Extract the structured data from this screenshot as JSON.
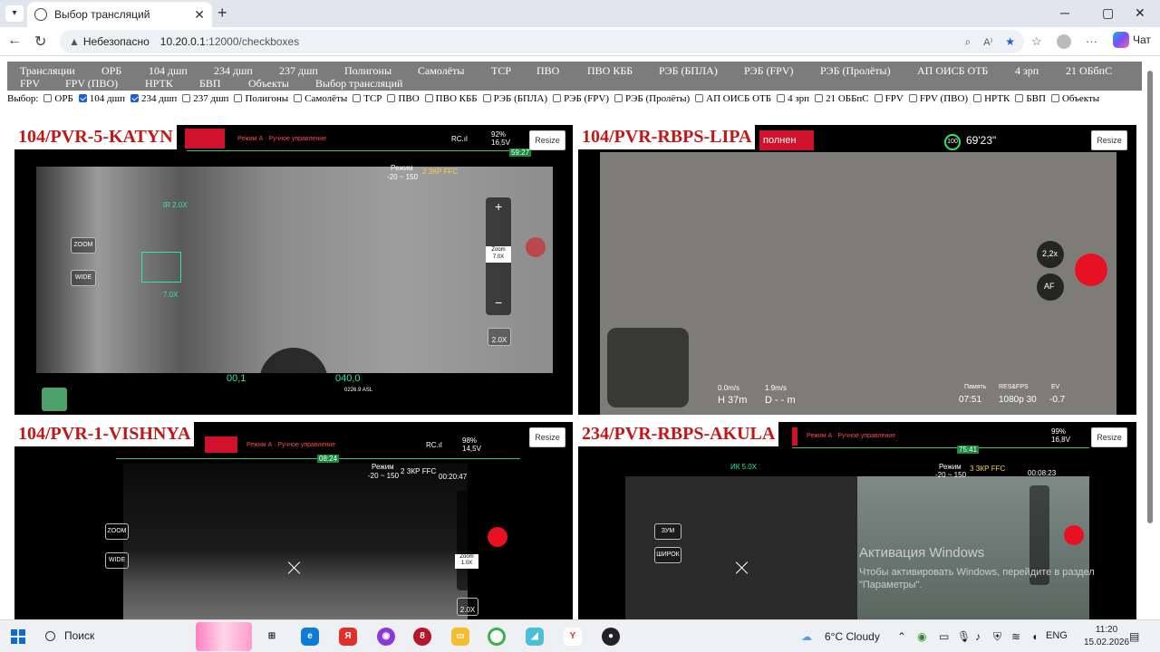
{
  "browser": {
    "tab_title": "Выбор трансляций",
    "tab_close": "✕",
    "new_tab": "+",
    "security_label": "Небезопасно",
    "url_host": "10.20.0.1",
    "url_rest": ":12000/checkboxes",
    "chat_label": "Чат"
  },
  "menu": {
    "items": [
      "Трансляции",
      "ОРБ",
      "104 дшп",
      "234 дшп",
      "237 дшп",
      "Полигоны",
      "Самолёты",
      "ТСР",
      "ПВО",
      "ПВО КББ",
      "РЭБ (БПЛА)",
      "РЭБ (FPV)",
      "РЭБ (Пролёты)",
      "АП ОИСБ ОТБ",
      "4 зрп",
      "21 ОБбпС",
      "FPV",
      "FPV (ПВО)",
      "НРТК",
      "БВП",
      "Объекты",
      "Выбор трансляций"
    ]
  },
  "checkboxes": {
    "label": "Выбор:",
    "items": [
      {
        "label": "ОРБ",
        "checked": false
      },
      {
        "label": "104 дшп",
        "checked": true
      },
      {
        "label": "234 дшп",
        "checked": true
      },
      {
        "label": "237 дшп",
        "checked": false
      },
      {
        "label": "Полигоны",
        "checked": false
      },
      {
        "label": "Самолёты",
        "checked": false
      },
      {
        "label": "ТСР",
        "checked": false
      },
      {
        "label": "ПВО",
        "checked": false
      },
      {
        "label": "ПВО КББ",
        "checked": false
      },
      {
        "label": "РЭБ (БПЛА)",
        "checked": false
      },
      {
        "label": "РЭБ (FPV)",
        "checked": false
      },
      {
        "label": "РЭБ (Пролёты)",
        "checked": false
      },
      {
        "label": "АП ОИСБ ОТБ",
        "checked": false
      },
      {
        "label": "4 зрп",
        "checked": false
      },
      {
        "label": "21 ОББпС",
        "checked": false
      },
      {
        "label": "FPV",
        "checked": false
      },
      {
        "label": "FPV (ПВО)",
        "checked": false
      },
      {
        "label": "НРТК",
        "checked": false
      },
      {
        "label": "БВП",
        "checked": false
      },
      {
        "label": "Объекты",
        "checked": false
      }
    ]
  },
  "feeds": [
    {
      "title": "104/PVR-5-KATYN",
      "resize": "Resize",
      "mode_text": "Режим А · Ручное управление",
      "rc_label": "RC.ıl",
      "battery": "92%",
      "voltage": "16,5V",
      "timer": "59:27",
      "mode_range": "-20 ~ 150",
      "zoom_btn": "ZOOM",
      "wide_btn": "WIDE",
      "zoom_value": "7.0X",
      "zoom_slider": "Zoom 7.0X",
      "lens": "2.0X",
      "ffc": "2 ЗКР  FFC",
      "alt": "040,0",
      "speed": "00,1",
      "asl": "0226.9 ASL",
      "ir": "IR 2.0X"
    },
    {
      "title": "104/PVR-RBPS-LIPA",
      "resize": "Resize",
      "status_badge": "полнен",
      "battery_pct": "100",
      "flight_time": "69'23\"",
      "zoom": "2,2x",
      "af": "AF",
      "speed_h": "0.0m/s",
      "speed_v": "1.9m/s",
      "height": "H 37m",
      "dist": "D - - m",
      "mem_label": "Память",
      "mem_time": "07:51",
      "res_label": "RES&FPS",
      "res_value": "1080p 30",
      "ev_label": "EV",
      "ev_value": "-0.7"
    },
    {
      "title": "104/PVR-1-VISHNYA",
      "resize": "Resize",
      "mode_text": "Режим А · Ручное управление",
      "rc_label": "RC.ıl",
      "battery": "98%",
      "voltage": "14,5V",
      "timer": "08:24",
      "ffc": "2 ЗКР  FFC",
      "rec_time": "00:20:47",
      "mode_range": "-20 ~ 150",
      "zoom_btn": "ZOOM",
      "wide_btn": "WIDE",
      "zoom_slider": "Zoom 1.0X",
      "lens": "2.0X"
    },
    {
      "title": "234/PVR-RBPS-AKULA",
      "resize": "Resize",
      "mode_text": "Режим А · Ручное управление",
      "battery": "99%",
      "voltage": "16,8V",
      "timer": "75:41",
      "ffc": "3 ЗКР  FFC",
      "rec_time": "00:08:23",
      "mode_range": "-20 ~ 150",
      "zoom_btn": "ЗУМ",
      "wide_btn": "ШИРОК",
      "ir": "ИК 5.0X"
    }
  ],
  "watermark": {
    "line1": "Активация Windows",
    "line2": "Чтобы активировать Windows, перейдите в раздел \"Параметры\"."
  },
  "taskbar": {
    "search": "Поиск",
    "weather": "6°C  Cloudy",
    "lang": "ENG",
    "time": "11:20",
    "date": "15.02.2026"
  }
}
